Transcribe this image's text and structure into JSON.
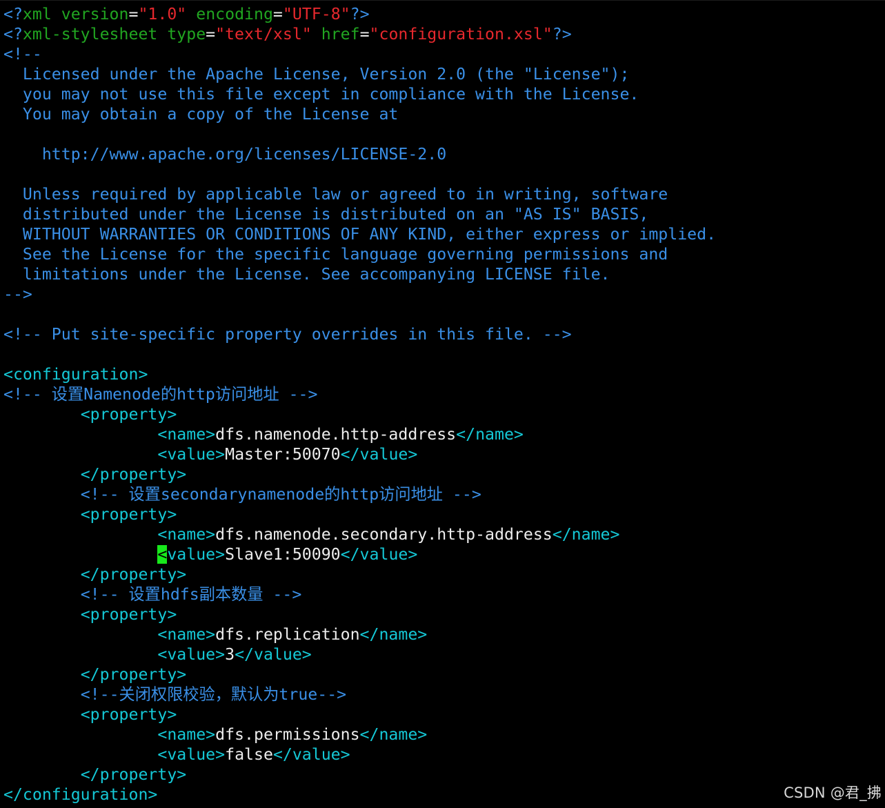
{
  "editor": {
    "cursor_line": 28,
    "colors": {
      "background": "#000000",
      "comment": "#3a8fe6",
      "pi_keyword": "#21a521",
      "string": "#e6282d",
      "tag": "#15c8d6",
      "text": "#ececec",
      "cursor": "#18e81c"
    },
    "lines": [
      [
        [
          "blue",
          "<?"
        ],
        [
          "green",
          "xml version"
        ],
        [
          "white",
          "="
        ],
        [
          "red",
          "\"1.0\""
        ],
        [
          "white",
          " "
        ],
        [
          "green",
          "encoding"
        ],
        [
          "white",
          "="
        ],
        [
          "red",
          "\"UTF-8\""
        ],
        [
          "blue",
          "?>"
        ]
      ],
      [
        [
          "blue",
          "<?"
        ],
        [
          "green",
          "xml-stylesheet type"
        ],
        [
          "white",
          "="
        ],
        [
          "red",
          "\"text/xsl\""
        ],
        [
          "white",
          " "
        ],
        [
          "green",
          "href"
        ],
        [
          "white",
          "="
        ],
        [
          "red",
          "\"configuration.xsl\""
        ],
        [
          "blue",
          "?>"
        ]
      ],
      [
        [
          "blue",
          "<!--"
        ]
      ],
      [
        [
          "blue",
          "  Licensed under the Apache License, Version 2.0 (the \"License\");"
        ]
      ],
      [
        [
          "blue",
          "  you may not use this file except in compliance with the License."
        ]
      ],
      [
        [
          "blue",
          "  You may obtain a copy of the License at"
        ]
      ],
      [],
      [
        [
          "blue",
          "    http://www.apache.org/licenses/LICENSE-2.0"
        ]
      ],
      [],
      [
        [
          "blue",
          "  Unless required by applicable law or agreed to in writing, software"
        ]
      ],
      [
        [
          "blue",
          "  distributed under the License is distributed on an \"AS IS\" BASIS,"
        ]
      ],
      [
        [
          "blue",
          "  WITHOUT WARRANTIES OR CONDITIONS OF ANY KIND, either express or implied."
        ]
      ],
      [
        [
          "blue",
          "  See the License for the specific language governing permissions and"
        ]
      ],
      [
        [
          "blue",
          "  limitations under the License. See accompanying LICENSE file."
        ]
      ],
      [
        [
          "blue",
          "-->"
        ]
      ],
      [],
      [
        [
          "blue",
          "<!-- Put site-specific property overrides in this file. -->"
        ]
      ],
      [],
      [
        [
          "cyan",
          "<configuration>"
        ]
      ],
      [
        [
          "blue",
          "<!-- 设置Namenode的http访问地址 -->"
        ]
      ],
      [
        [
          "white",
          "        "
        ],
        [
          "cyan",
          "<property>"
        ]
      ],
      [
        [
          "white",
          "                "
        ],
        [
          "cyan",
          "<name>"
        ],
        [
          "white",
          "dfs.namenode.http-address"
        ],
        [
          "cyan",
          "</name>"
        ]
      ],
      [
        [
          "white",
          "                "
        ],
        [
          "cyan",
          "<value>"
        ],
        [
          "white",
          "Master:50070"
        ],
        [
          "cyan",
          "</value>"
        ]
      ],
      [
        [
          "white",
          "        "
        ],
        [
          "cyan",
          "</property>"
        ]
      ],
      [
        [
          "white",
          "        "
        ],
        [
          "blue",
          "<!-- 设置secondarynamenode的http访问地址 -->"
        ]
      ],
      [
        [
          "white",
          "        "
        ],
        [
          "cyan",
          "<property>"
        ]
      ],
      [
        [
          "white",
          "                "
        ],
        [
          "cyan",
          "<name>"
        ],
        [
          "white",
          "dfs.namenode.secondary.http-address"
        ],
        [
          "cyan",
          "</name>"
        ]
      ],
      [
        [
          "white",
          "                "
        ],
        [
          "cursor",
          "<"
        ],
        [
          "cyan",
          "value>"
        ],
        [
          "white",
          "Slave1:50090"
        ],
        [
          "cyan",
          "</value>"
        ]
      ],
      [
        [
          "white",
          "        "
        ],
        [
          "cyan",
          "</property>"
        ]
      ],
      [
        [
          "white",
          "        "
        ],
        [
          "blue",
          "<!-- 设置hdfs副本数量 -->"
        ]
      ],
      [
        [
          "white",
          "        "
        ],
        [
          "cyan",
          "<property>"
        ]
      ],
      [
        [
          "white",
          "                "
        ],
        [
          "cyan",
          "<name>"
        ],
        [
          "white",
          "dfs.replication"
        ],
        [
          "cyan",
          "</name>"
        ]
      ],
      [
        [
          "white",
          "                "
        ],
        [
          "cyan",
          "<value>"
        ],
        [
          "white",
          "3"
        ],
        [
          "cyan",
          "</value>"
        ]
      ],
      [
        [
          "white",
          "        "
        ],
        [
          "cyan",
          "</property>"
        ]
      ],
      [
        [
          "white",
          "        "
        ],
        [
          "blue",
          "<!--关闭权限校验，默认为true-->"
        ]
      ],
      [
        [
          "white",
          "        "
        ],
        [
          "cyan",
          "<property>"
        ]
      ],
      [
        [
          "white",
          "                "
        ],
        [
          "cyan",
          "<name>"
        ],
        [
          "white",
          "dfs.permissions"
        ],
        [
          "cyan",
          "</name>"
        ]
      ],
      [
        [
          "white",
          "                "
        ],
        [
          "cyan",
          "<value>"
        ],
        [
          "white",
          "false"
        ],
        [
          "cyan",
          "</value>"
        ]
      ],
      [
        [
          "white",
          "        "
        ],
        [
          "cyan",
          "</property>"
        ]
      ],
      [
        [
          "cyan",
          "</configuration>"
        ]
      ]
    ]
  },
  "watermark": {
    "text": "CSDN @君_拂"
  }
}
